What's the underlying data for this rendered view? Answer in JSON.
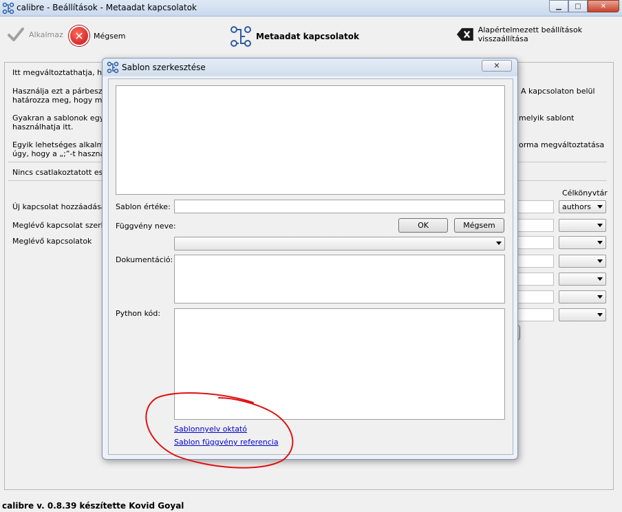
{
  "window": {
    "title": "calibre - Beállítások - Metaadat kapcsolatok"
  },
  "toolbar": {
    "apply_label": "Alkalmaz",
    "cancel_label": "Mégsem",
    "section_title": "Metaadat kapcsolatok",
    "restore_label": "Alapértelmezett beállítások visszaállítása"
  },
  "main": {
    "para1": "Itt megváltoztathatja, hogy",
    "para2_l1": "Használja ezt a párbeszédá",
    "para2_l2": "határozza meg, hogy melyik",
    "para2_r": "A kapcsolaton belül",
    "para3_l1": "Gyakran a sablonok egysze",
    "para3_l2": "használhatja itt.",
    "para3_r": "melyik sablont",
    "para4_l1": "Egyik lehetséges alkalmazá",
    "para4_l2": "úgy, hogy a „;”-t használja",
    "para4_r": "orma megváltoztatása",
    "no_device": "Nincs csatlakoztatott eszkö",
    "target_header": "Célkönyvtár",
    "add_label": "Új kapcsolat hozzáadása",
    "edit_label": "Meglévő kapcsolat szerkesz",
    "existing_label": "Meglévő kapcsolatok",
    "target_first_value": "authors"
  },
  "dialog": {
    "title": "Sablon szerkesztése",
    "template_value_label": "Sablon értéke:",
    "function_name_label": "Függvény neve:",
    "ok_label": "OK",
    "cancel_label": "Mégsem",
    "documentation_label": "Dokumentáció:",
    "python_code_label": "Python kód:",
    "tutorial_link": "Sablonnyelv oktató",
    "reference_link": "Sablon függvény referencia"
  },
  "statusbar": {
    "text": "calibre v. 0.8.39 készítette Kovid Goyal"
  },
  "colors": {
    "annotation": "#e01010",
    "link": "#0000cc"
  }
}
